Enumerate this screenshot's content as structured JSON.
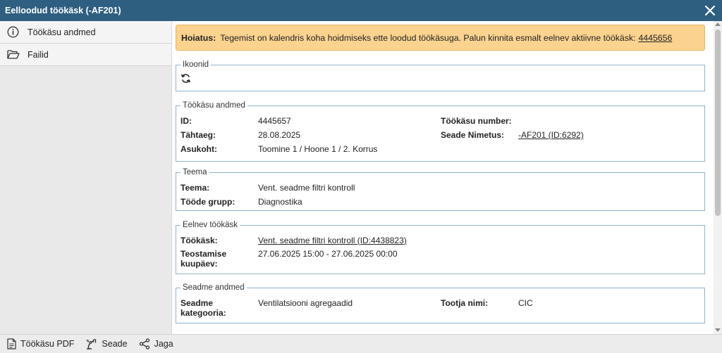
{
  "window": {
    "title": "Eelloodud töökäsk (-AF201)"
  },
  "sidebar": {
    "items": [
      {
        "label": "Töökäsu andmed"
      },
      {
        "label": "Failid"
      }
    ]
  },
  "warning": {
    "prefix": "Hoiatus:",
    "text": "Tegemist on kalendris koha hoidmiseks ette loodud töökäsuga. Palun kinnita esmalt eelnev aktiivne töökäsk:",
    "link": "4445656"
  },
  "icons_section": {
    "legend": "Ikoonid"
  },
  "work_order": {
    "legend": "Töökäsu andmed",
    "id_label": "ID:",
    "id_value": "4445657",
    "deadline_label": "Tähtaeg:",
    "deadline_value": "28.08.2025",
    "location_label": "Asukoht:",
    "location_value": "Toomine 1 / Hoone 1 / 2. Korrus",
    "number_label": "Töökäsu number:",
    "number_value": "",
    "device_label": "Seade Nimetus:",
    "device_value": "-AF201 (ID:6292)"
  },
  "theme": {
    "legend": "Teema",
    "theme_label": "Teema:",
    "theme_value": "Vent. seadme filtri kontroll",
    "group_label": "Tööde grupp:",
    "group_value": "Diagnostika"
  },
  "previous": {
    "legend": "Eelnev töökäsk",
    "order_label": "Töökäsk:",
    "order_value": "Vent. seadme filtri kontroll (ID:4438823)",
    "date_label_1": "Teostamise",
    "date_label_2": "kuupäev:",
    "date_value": "27.06.2025 15:00 - 27.06.2025 00:00"
  },
  "device_data": {
    "legend": "Seadme andmed",
    "category_label_1": "Seadme",
    "category_label_2": "kategooria:",
    "category_value": "Ventilatsiooni agregaadid",
    "maker_label": "Tootja nimi:",
    "maker_value": "CIC"
  },
  "bottombar": {
    "pdf_label": "Töökäsu PDF",
    "device_label": "Seade",
    "share_label": "Jaga"
  },
  "colors": {
    "titlebar": "#2e5f80",
    "warning_bg": "#fbd28e",
    "section_border": "#8fb2cc"
  }
}
